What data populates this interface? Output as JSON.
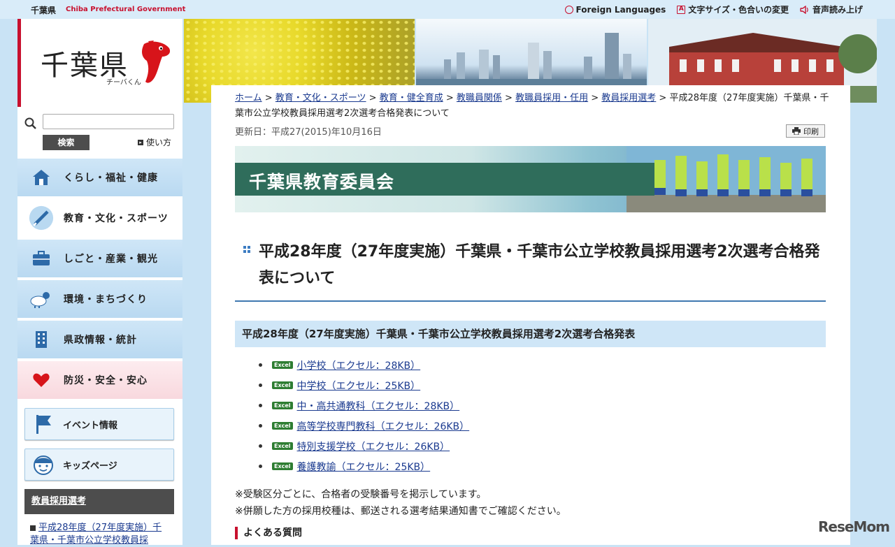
{
  "topbar": {
    "site_name": "千葉県",
    "site_name_en": "Chiba Prefectural Government",
    "links": [
      "Foreign Languages",
      "文字サイズ・色合いの変更",
      "音声読み上げ"
    ]
  },
  "sidebar": {
    "logo": "千葉県",
    "mascot_name": "チーバくん",
    "search_button": "検索",
    "howto": "使い方",
    "nav": [
      "くらし・福祉・健康",
      "教育・文化・スポーツ",
      "しごと・産業・観光",
      "環境・まちづくり",
      "県政情報・統計",
      "防災・安全・安心"
    ],
    "sub_buttons": [
      "イベント情報",
      "キッズページ"
    ],
    "section_heading": "教員採用選考",
    "section_link": "平成28年度（27年度実施）千葉県・千葉市公立学校教員採"
  },
  "breadcrumb": {
    "links": [
      "ホーム",
      "教育・文化・スポーツ",
      "教育・健全育成",
      "教職員関係",
      "教職員採用・任用",
      "教員採用選考"
    ],
    "current": "平成28年度（27年度実施）千葉県・千葉市公立学校教員採用選考2次選考合格発表について"
  },
  "updated": "更新日：平成27(2015)年10月16日",
  "print": "印刷",
  "banner_title": "千葉県教育委員会",
  "page_title": "平成28年度（27年度実施）千葉県・千葉市公立学校教員採用選考2次選考合格発表について",
  "section_title": "平成28年度（27年度実施）千葉県・千葉市公立学校教員採用選考2次選考合格発表",
  "excel_badge": "Excel",
  "files": [
    "小学校（エクセル：28KB）",
    "中学校（エクセル：25KB）",
    "中・高共通教科（エクセル：28KB）",
    "高等学校専門教科（エクセル：26KB）",
    "特別支援学校（エクセル：26KB）",
    "養護教諭（エクセル：25KB）"
  ],
  "notes": [
    "※受験区分ごとに、合格者の受験番号を掲示しています。",
    "※併願した方の採用校種は、郵送される選考結果通知書でご確認ください。"
  ],
  "faq": "よくある質問",
  "watermark": "ReseMom"
}
